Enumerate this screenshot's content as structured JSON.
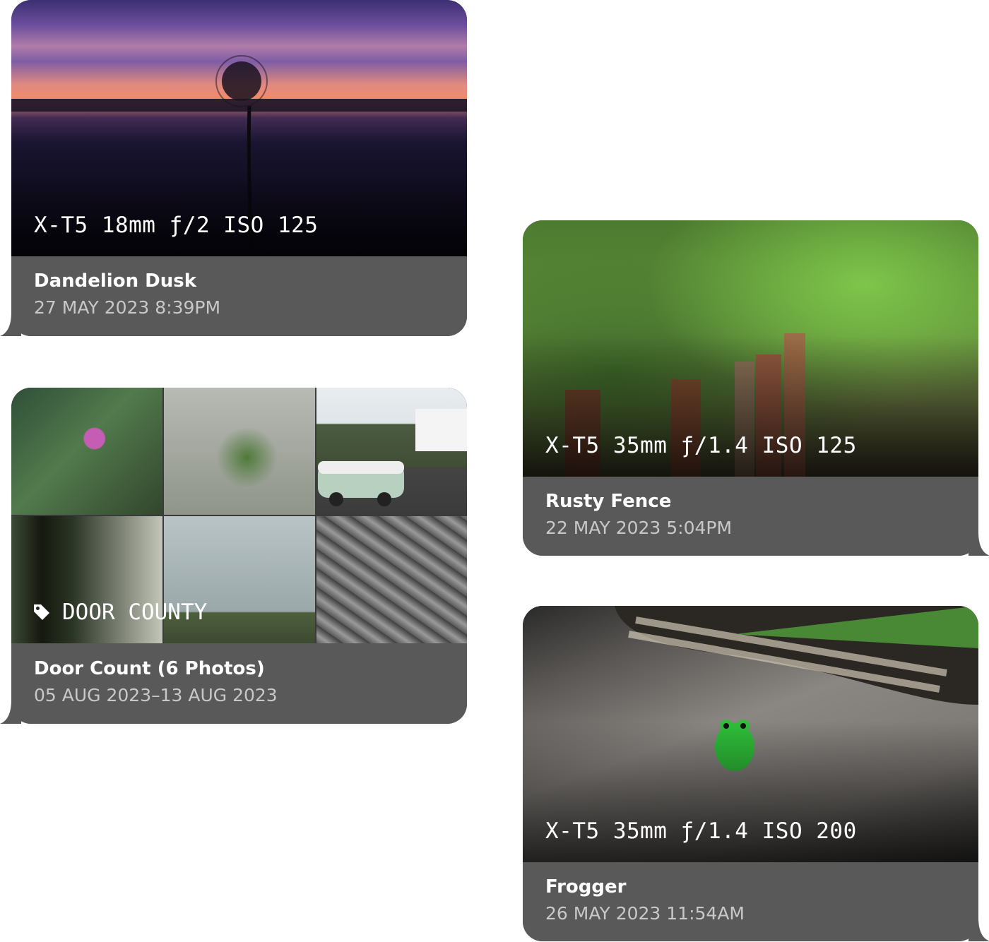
{
  "cards": [
    {
      "exif": "X-T5 18mm ƒ/2 ISO 125",
      "title": "Dandelion Dusk",
      "date": "27 MAY 2023 8:39PM"
    },
    {
      "tag": "DOOR COUNTY",
      "tag_icon": "tag-icon",
      "title": "Door Count (6 Photos)",
      "date": "05 AUG 2023–13 AUG 2023"
    },
    {
      "exif": "X-T5 35mm ƒ/1.4 ISO 125",
      "title": "Rusty Fence",
      "date": "22 MAY 2023 5:04PM"
    },
    {
      "exif": "X-T5 35mm ƒ/1.4 ISO 200",
      "title": "Frogger",
      "date": "26 MAY 2023 11:54AM"
    }
  ],
  "colors": {
    "bubble": "#595959",
    "caption_title": "#ffffff",
    "caption_date": "#c8c8c8"
  }
}
